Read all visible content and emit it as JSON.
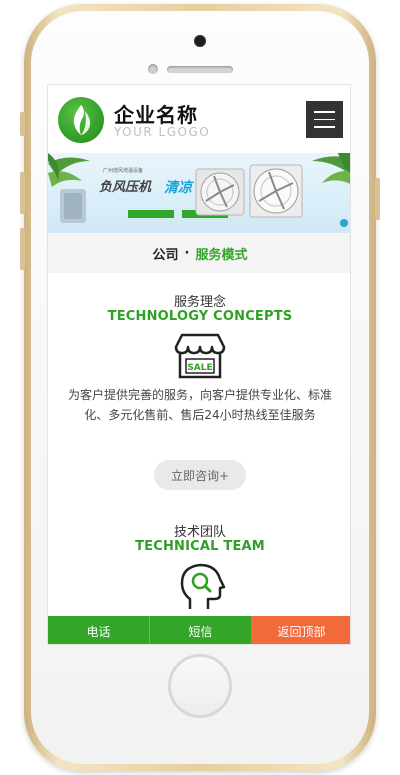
{
  "header": {
    "brand_name": "企业名称",
    "brand_sub": "YOUR LGOGO",
    "menu_icon": "hamburger-icon"
  },
  "banner": {
    "small_text": "广州增风增温设备",
    "big_text": "负风压机",
    "accent_text": "清凉"
  },
  "breadcrumb": {
    "item1": "公司",
    "separator": "·",
    "item2": "服务模式"
  },
  "section1": {
    "title_cn": "服务理念",
    "title_en": "TECHNOLOGY CONCEPTS",
    "icon": "sale-shop-icon",
    "icon_label": "SALE",
    "description": "为客户提供完善的服务，向客户提供专业化、标准化、多元化售前、售后24小时热线至佳服务",
    "button_label": "立即咨询+"
  },
  "section2": {
    "title_cn": "技术团队",
    "title_en": "TECHNICAL TEAM",
    "icon": "head-search-icon"
  },
  "bottom_bar": {
    "call": "电话",
    "sms": "短信",
    "back_to_top": "返回顶部"
  },
  "colors": {
    "brand_green": "#33a62a",
    "accent_orange": "#f26a3a",
    "menu_dark": "#333333"
  }
}
